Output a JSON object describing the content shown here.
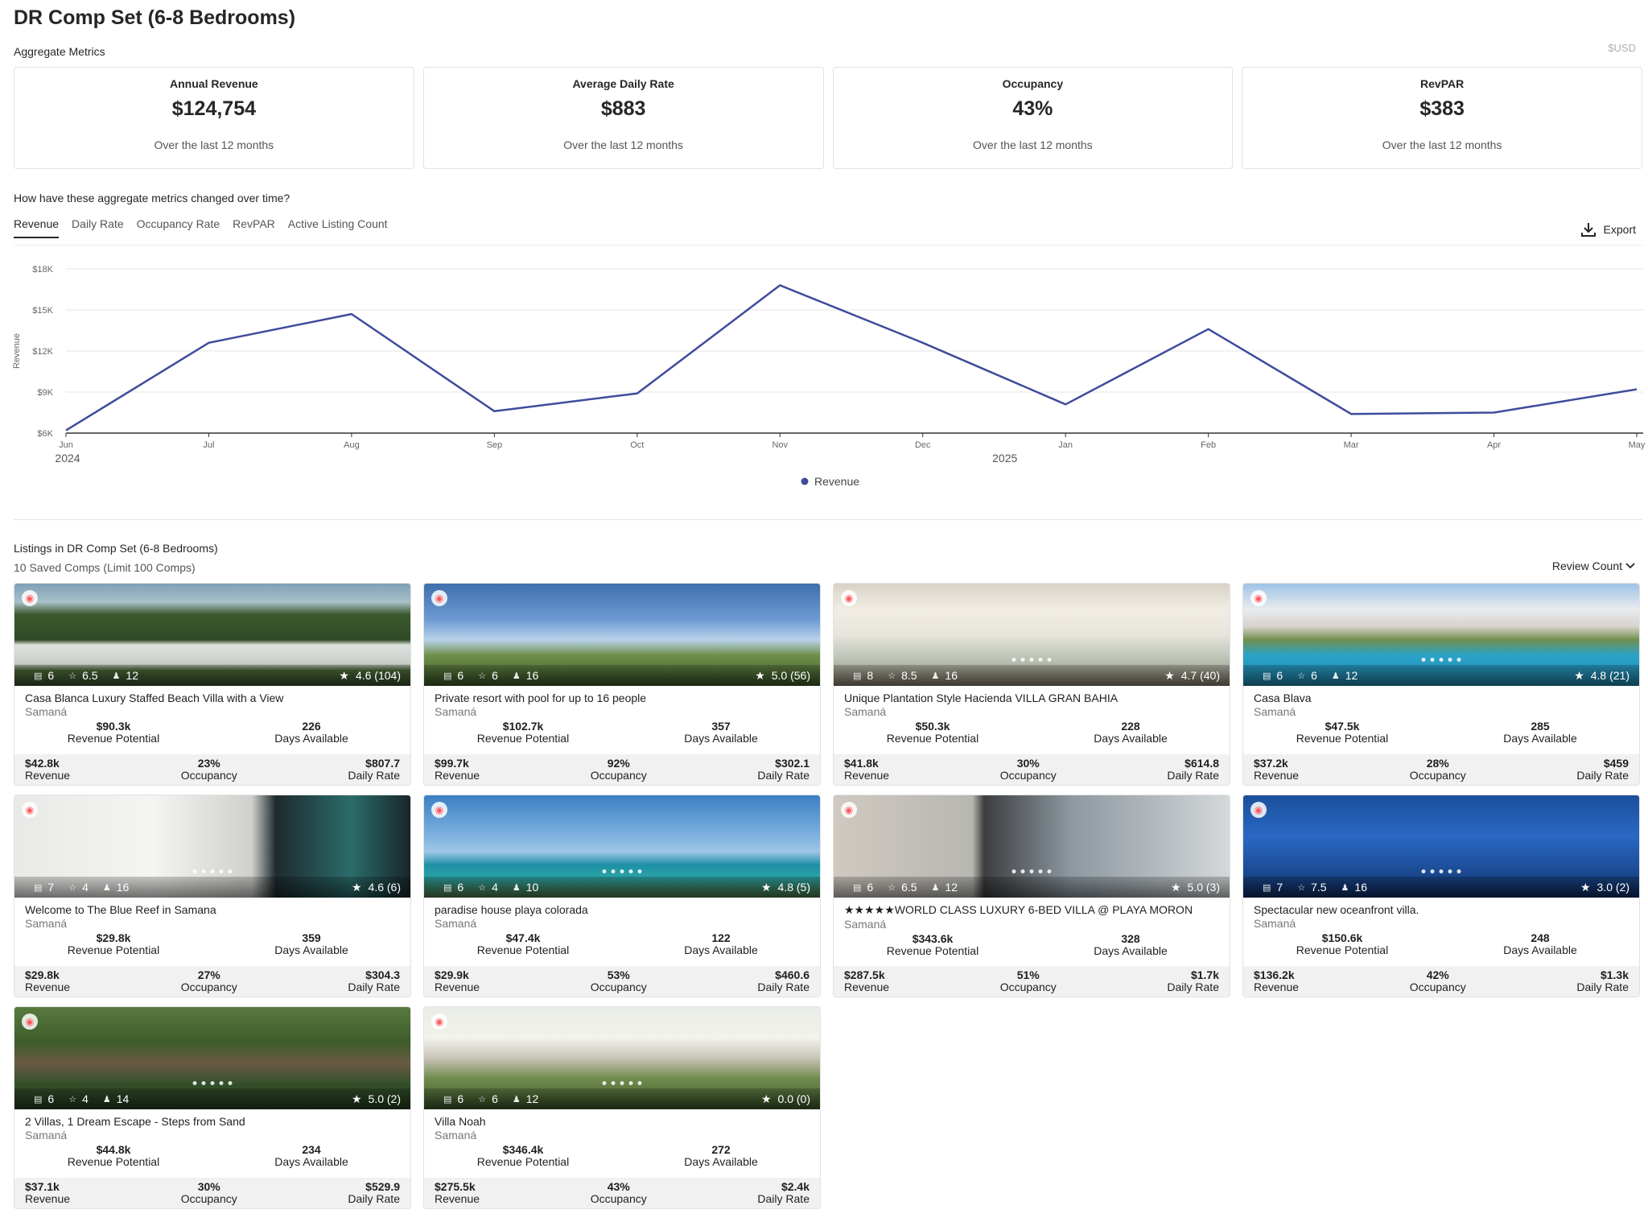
{
  "page": {
    "title": "DR Comp Set (6-8 Bedrooms)",
    "section_label": "Aggregate Metrics",
    "currency": "$USD"
  },
  "metrics": [
    {
      "label": "Annual Revenue",
      "value": "$124,754",
      "sub": "Over the last 12 months"
    },
    {
      "label": "Average Daily Rate",
      "value": "$883",
      "sub": "Over the last 12 months"
    },
    {
      "label": "Occupancy",
      "value": "43%",
      "sub": "Over the last 12 months"
    },
    {
      "label": "RevPAR",
      "value": "$383",
      "sub": "Over the last 12 months"
    }
  ],
  "trend": {
    "question": "How have these aggregate metrics changed over time?",
    "tabs": [
      "Revenue",
      "Daily Rate",
      "Occupancy Rate",
      "RevPAR",
      "Active Listing Count"
    ],
    "active_tab": "Revenue",
    "export_label": "Export"
  },
  "chart_data": {
    "type": "line",
    "ylabel": "Revenue",
    "y_ticks": [
      "$6K",
      "$9K",
      "$12K",
      "$15K",
      "$18K"
    ],
    "ylim": [
      6000,
      18000
    ],
    "x": [
      "Jun",
      "Jul",
      "Aug",
      "Sep",
      "Oct",
      "Nov",
      "Dec",
      "Jan",
      "Feb",
      "Mar",
      "Apr",
      "May"
    ],
    "year_labels": [
      {
        "label": "2024",
        "at": "Jun"
      },
      {
        "label": "2025",
        "at": "Dec"
      }
    ],
    "series": [
      {
        "name": "Revenue",
        "color": "#3f4b9c",
        "values": [
          6200,
          12600,
          14700,
          7600,
          8900,
          16800,
          12600,
          8100,
          13600,
          7400,
          7500,
          9200
        ]
      }
    ],
    "legend": "bottom-center",
    "grid": true
  },
  "listings": {
    "title": "Listings in DR Comp Set (6-8 Bedrooms)",
    "subtitle": "10 Saved Comps (Limit 100 Comps)",
    "sort_label": "Review Count",
    "labels": {
      "revenue_potential": "Revenue Potential",
      "days_available": "Days Available",
      "revenue": "Revenue",
      "occupancy": "Occupancy",
      "daily_rate": "Daily Rate"
    },
    "items": [
      {
        "name": "Casa Blanca Luxury Staffed Beach Villa with a View",
        "location": "Samaná",
        "beds": "6",
        "baths": "6.5",
        "guests": "12",
        "rating": "4.6 (104)",
        "revenue_potential": "$90.3k",
        "days_available": "226",
        "revenue": "$42.8k",
        "occupancy": "23%",
        "daily_rate": "$807.7",
        "scene": "villa-white"
      },
      {
        "name": "Private resort with pool for up to 16 people",
        "location": "Samaná",
        "beds": "6",
        "baths": "6",
        "guests": "16",
        "rating": "5.0 (56)",
        "revenue_potential": "$102.7k",
        "days_available": "357",
        "revenue": "$99.7k",
        "occupancy": "92%",
        "daily_rate": "$302.1",
        "scene": "sky-palms"
      },
      {
        "name": "Unique Plantation Style Hacienda VILLA GRAN BAHIA",
        "location": "Samaná",
        "beds": "8",
        "baths": "8.5",
        "guests": "16",
        "rating": "4.7 (40)",
        "revenue_potential": "$50.3k",
        "days_available": "228",
        "revenue": "$41.8k",
        "occupancy": "30%",
        "daily_rate": "$614.8",
        "scene": "interior"
      },
      {
        "name": "Casa Blava",
        "location": "Samaná",
        "beds": "6",
        "baths": "6",
        "guests": "12",
        "rating": "4.8 (21)",
        "revenue_potential": "$47.5k",
        "days_available": "285",
        "revenue": "$37.2k",
        "occupancy": "28%",
        "daily_rate": "$459",
        "scene": "pool"
      },
      {
        "name": "Welcome to The Blue Reef in Samana",
        "location": "Samaná",
        "beds": "7",
        "baths": "4",
        "guests": "16",
        "rating": "4.6 (6)",
        "revenue_potential": "$29.8k",
        "days_available": "359",
        "revenue": "$29.8k",
        "occupancy": "27%",
        "daily_rate": "$304.3",
        "scene": "lamp"
      },
      {
        "name": "paradise house playa colorada",
        "location": "Samaná",
        "beds": "6",
        "baths": "4",
        "guests": "10",
        "rating": "4.8 (5)",
        "revenue_potential": "$47.4k",
        "days_available": "122",
        "revenue": "$29.9k",
        "occupancy": "53%",
        "daily_rate": "$460.6",
        "scene": "bay"
      },
      {
        "name": "★★★★★WORLD CLASS LUXURY 6-BED VILLA @ PLAYA MORON",
        "location": "Samaná",
        "beds": "6",
        "baths": "6.5",
        "guests": "12",
        "rating": "5.0 (3)",
        "revenue_potential": "$343.6k",
        "days_available": "328",
        "revenue": "$287.5k",
        "occupancy": "51%",
        "daily_rate": "$1.7k",
        "scene": "infinity"
      },
      {
        "name": "Spectacular new oceanfront villa.",
        "location": "Samaná",
        "beds": "7",
        "baths": "7.5",
        "guests": "16",
        "rating": "3.0 (2)",
        "revenue_potential": "$150.6k",
        "days_available": "248",
        "revenue": "$136.2k",
        "occupancy": "42%",
        "daily_rate": "$1.3k",
        "scene": "blue-pool"
      },
      {
        "name": "2 Villas, 1 Dream Escape - Steps from Sand",
        "location": "Samaná",
        "beds": "6",
        "baths": "4",
        "guests": "14",
        "rating": "5.0 (2)",
        "revenue_potential": "$44.8k",
        "days_available": "234",
        "revenue": "$37.1k",
        "occupancy": "30%",
        "daily_rate": "$529.9",
        "scene": "aerial"
      },
      {
        "name": "Villa Noah",
        "location": "Samaná",
        "beds": "6",
        "baths": "6",
        "guests": "12",
        "rating": "0.0 (0)",
        "revenue_potential": "$346.4k",
        "days_available": "272",
        "revenue": "$275.5k",
        "occupancy": "43%",
        "daily_rate": "$2.4k",
        "scene": "modern"
      }
    ]
  }
}
